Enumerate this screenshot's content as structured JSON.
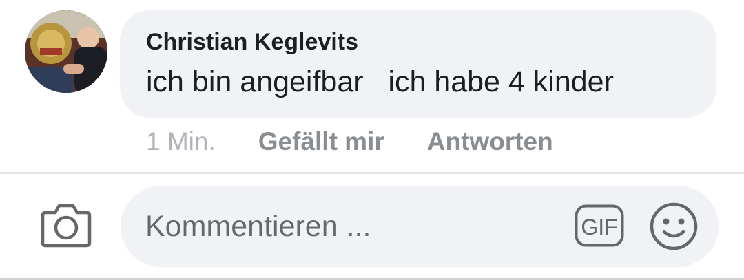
{
  "comment": {
    "author": "Christian Keglevits",
    "text": "ich bin angeifbar   ich habe 4 kinder",
    "time": "1 Min.",
    "like_label": "Gefällt mir",
    "reply_label": "Antworten",
    "avatar_icon": "avatar-photo"
  },
  "composer": {
    "placeholder": "Kommentieren ...",
    "camera_icon": "camera-icon",
    "gif_label": "GIF",
    "emoji_icon": "smiley-icon"
  }
}
